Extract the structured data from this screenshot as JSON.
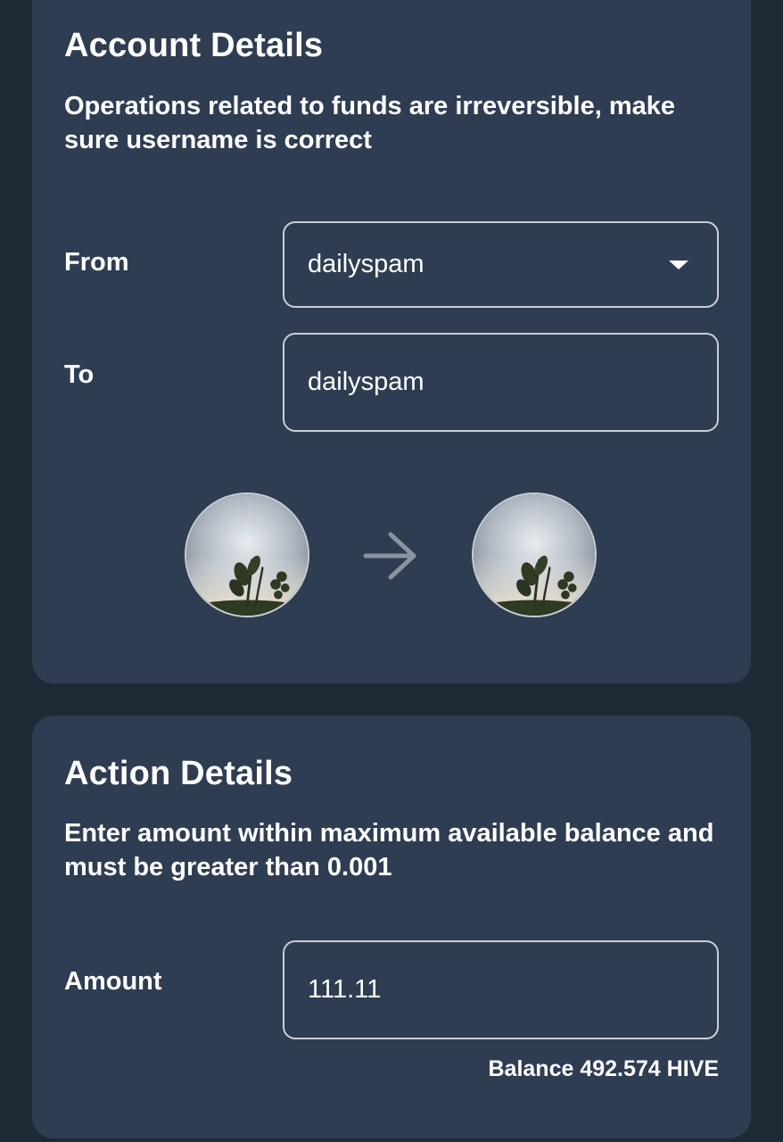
{
  "account_details": {
    "title": "Account Details",
    "description": "Operations related to funds are irreversible, make sure username is correct",
    "from_label": "From",
    "from_value": "dailyspam",
    "to_label": "To",
    "to_value": "dailyspam",
    "from_avatar_icon": "avatar-image",
    "arrow_icon": "arrow-right-icon",
    "to_avatar_icon": "avatar-image"
  },
  "action_details": {
    "title": "Action Details",
    "description": "Enter amount within maximum available balance and must be greater than 0.001",
    "amount_label": "Amount",
    "amount_value": "111.11",
    "balance_text": "Balance 492.574 HIVE"
  },
  "colors": {
    "page_background": "#1f2a37",
    "card_background": "#2f3d52",
    "field_border": "#c9ced6",
    "text": "#ffffff",
    "arrow": "#8a949f"
  }
}
